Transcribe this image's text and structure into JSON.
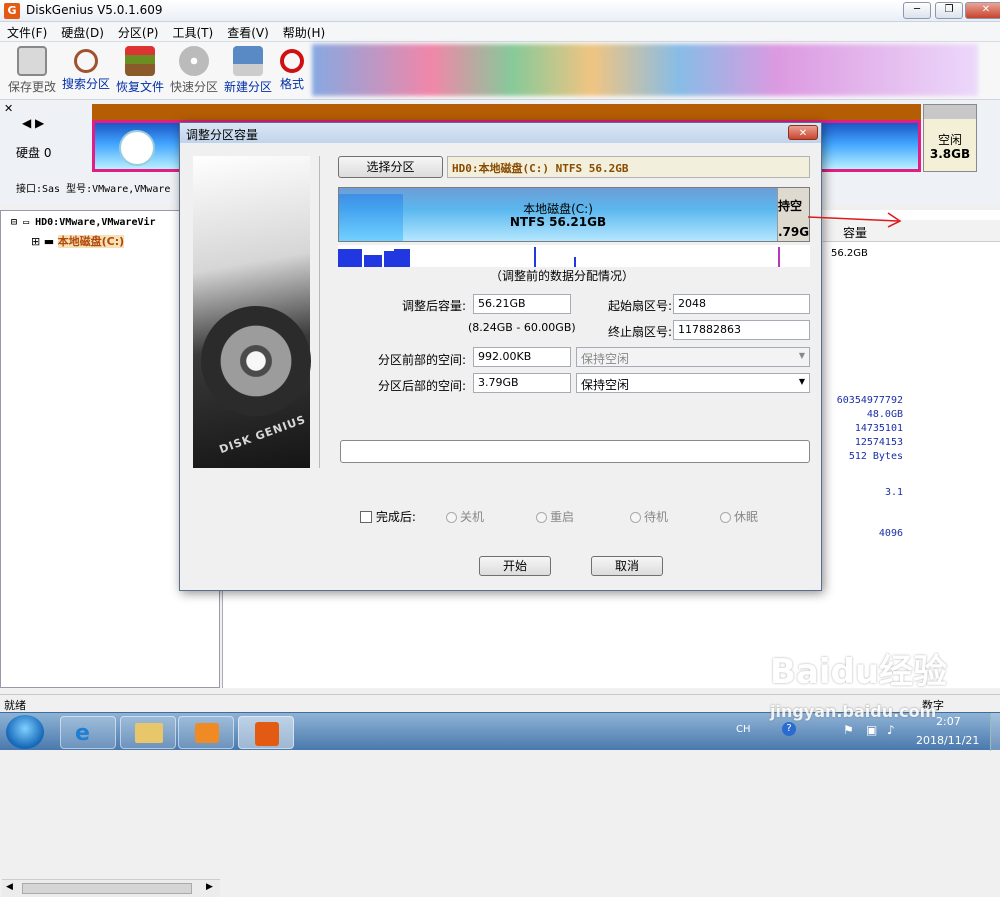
{
  "app": {
    "title": "DiskGenius V5.0.1.609",
    "logo_letter": "G",
    "window_buttons": [
      "─",
      "❐",
      "✕"
    ]
  },
  "menu": [
    "文件(F)",
    "硬盘(D)",
    "分区(P)",
    "工具(T)",
    "查看(V)",
    "帮助(H)"
  ],
  "toolbar": {
    "items": [
      {
        "label": "保存更改",
        "icon": "save-disk-icon"
      },
      {
        "label": "搜索分区",
        "icon": "magnifier-icon"
      },
      {
        "label": "恢复文件",
        "icon": "recover-box-icon"
      },
      {
        "label": "快速分区",
        "icon": "cd-icon"
      },
      {
        "label": "新建分区",
        "icon": "computer-icon"
      },
      {
        "label": "格式",
        "icon": "no-sign-icon"
      }
    ]
  },
  "disk_panel": {
    "disk_label": "硬盘 0",
    "interface_line": "接口:Sas  型号:VMware,VMware",
    "free_label": "空闲",
    "free_size": "3.8GB"
  },
  "tree": {
    "disk_node": "HD0:VMware,VMwareVir",
    "partition_node": "本地磁盘(C:)"
  },
  "right_panel": {
    "column_header": "容量",
    "capacity_value": "56.2GB",
    "values": [
      "60354977792",
      "48.0GB",
      "14735101",
      "12574153",
      "512 Bytes",
      "3.1",
      "4096"
    ]
  },
  "status": {
    "left": "就绪",
    "right": "数字"
  },
  "taskbar": {
    "lang": "CH",
    "time": "2:07",
    "date": "2018/11/21"
  },
  "dialog": {
    "title": "调整分区容量",
    "close": "✕",
    "select_button": "选择分区",
    "partition_name": "HD0:本地磁盘(C:) NTFS 56.2GB",
    "bar_name": "本地磁盘(C:)",
    "bar_size": "NTFS 56.21GB",
    "free_top": "持空",
    "free_bottom": ".79G",
    "distribution_caption": "（调整前的数据分配情况）",
    "brand": "DISK GENIUS",
    "fields": {
      "new_size_label": "调整后容量:",
      "new_size_value": "56.21GB",
      "range_hint": "(8.24GB - 60.00GB)",
      "start_sector_label": "起始扇区号:",
      "start_sector_value": "2048",
      "end_sector_label": "终止扇区号:",
      "end_sector_value": "117882863",
      "before_space_label": "分区前部的空间:",
      "before_space_value": "992.00KB",
      "before_space_option": "保持空闲",
      "after_space_label": "分区后部的空间:",
      "after_space_value": "3.79GB",
      "after_space_option": "保持空闲"
    },
    "after_done_label": "完成后:",
    "after_done_options": [
      "关机",
      "重启",
      "待机",
      "休眠"
    ],
    "start_button": "开始",
    "cancel_button": "取消"
  },
  "watermark": {
    "brand": "Baidu经验",
    "url": "jingyan.baidu.com"
  }
}
